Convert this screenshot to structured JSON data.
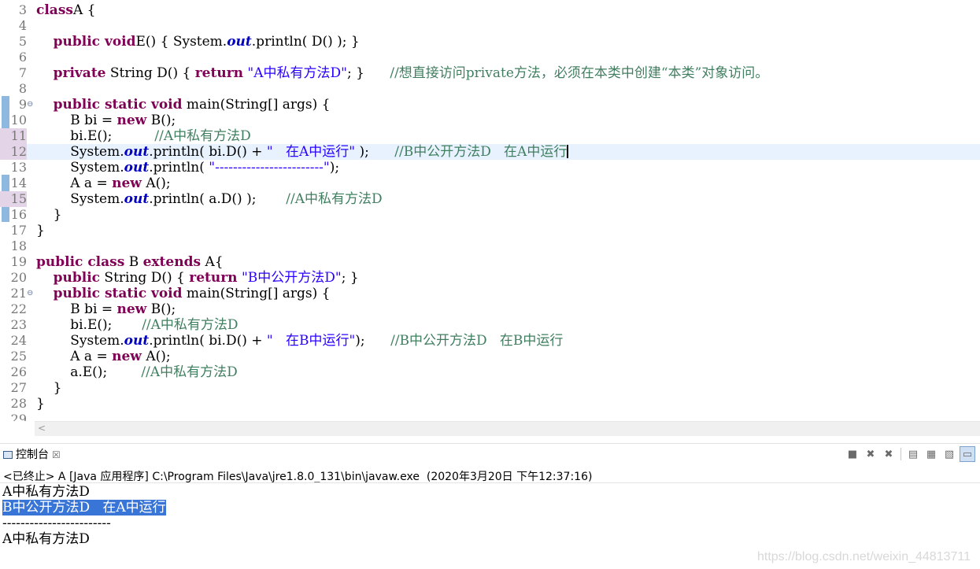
{
  "editor": {
    "current_line": "12",
    "lines": [
      {
        "n": "3",
        "mark": false,
        "fold": "",
        "current": false,
        "tokens": [
          [
            "kw",
            "class"
          ],
          [
            "",
            "A {"
          ]
        ]
      },
      {
        "n": "4",
        "mark": false,
        "fold": "",
        "current": false,
        "tokens": []
      },
      {
        "n": "5",
        "mark": false,
        "fold": "",
        "current": false,
        "tokens": [
          [
            "",
            "    "
          ],
          [
            "kw",
            "public void"
          ],
          [
            "",
            "E() { System."
          ],
          [
            "fld",
            "out"
          ],
          [
            "",
            ".println( D() ); }"
          ]
        ]
      },
      {
        "n": "6",
        "mark": false,
        "fold": "",
        "current": false,
        "tokens": []
      },
      {
        "n": "7",
        "mark": false,
        "fold": "",
        "current": false,
        "tokens": [
          [
            "",
            "    "
          ],
          [
            "kw",
            "private"
          ],
          [
            "",
            " String D() { "
          ],
          [
            "kw",
            "return"
          ],
          [
            "",
            " "
          ],
          [
            "str",
            "\"A中私有方法D\""
          ],
          [
            "",
            "; }      "
          ],
          [
            "cmt",
            "//想直接访问private方法，必须在本类中创建“本类”对象访问。"
          ]
        ]
      },
      {
        "n": "8",
        "mark": false,
        "fold": "",
        "current": false,
        "tokens": []
      },
      {
        "n": "9",
        "mark": false,
        "fold": "⊖",
        "current": false,
        "tokens": [
          [
            "",
            "    "
          ],
          [
            "kw",
            "public static void"
          ],
          [
            "",
            " main(String[] args) {"
          ]
        ]
      },
      {
        "n": "10",
        "mark": false,
        "fold": "",
        "current": false,
        "tokens": [
          [
            "",
            "        B bi = "
          ],
          [
            "kw",
            "new"
          ],
          [
            "",
            " B();"
          ]
        ]
      },
      {
        "n": "11",
        "mark": true,
        "fold": "",
        "current": false,
        "tokens": [
          [
            "",
            "        bi.E();          "
          ],
          [
            "cmt",
            "//A中私有方法D"
          ]
        ]
      },
      {
        "n": "12",
        "mark": true,
        "fold": "",
        "current": true,
        "tokens": [
          [
            "",
            "        System."
          ],
          [
            "fld",
            "out"
          ],
          [
            "",
            ".println( bi.D() + "
          ],
          [
            "str",
            "\"   在A中运行\""
          ],
          [
            "",
            " );      "
          ],
          [
            "cmt",
            "//B中公开方法D   在A中运行"
          ]
        ],
        "caret": true
      },
      {
        "n": "13",
        "mark": false,
        "fold": "",
        "current": false,
        "tokens": [
          [
            "",
            "        System."
          ],
          [
            "fld",
            "out"
          ],
          [
            "",
            ".println( "
          ],
          [
            "str",
            "\"------------------------\""
          ],
          [
            "",
            ");"
          ]
        ]
      },
      {
        "n": "14",
        "mark": false,
        "fold": "",
        "current": false,
        "tokens": [
          [
            "",
            "        A a = "
          ],
          [
            "kw",
            "new"
          ],
          [
            "",
            " A();"
          ]
        ]
      },
      {
        "n": "15",
        "mark": true,
        "fold": "",
        "current": false,
        "tokens": [
          [
            "",
            "        System."
          ],
          [
            "fld",
            "out"
          ],
          [
            "",
            ".println( a.D() );       "
          ],
          [
            "cmt",
            "//A中私有方法D"
          ]
        ]
      },
      {
        "n": "16",
        "mark": false,
        "fold": "",
        "current": false,
        "tokens": [
          [
            "",
            "    }"
          ]
        ]
      },
      {
        "n": "17",
        "mark": false,
        "fold": "",
        "current": false,
        "tokens": [
          [
            "",
            "}"
          ]
        ]
      },
      {
        "n": "18",
        "mark": false,
        "fold": "",
        "current": false,
        "tokens": []
      },
      {
        "n": "19",
        "mark": false,
        "fold": "",
        "current": false,
        "tokens": [
          [
            "kw",
            "public class"
          ],
          [
            "",
            " B "
          ],
          [
            "kw",
            "extends"
          ],
          [
            "",
            " A{"
          ]
        ]
      },
      {
        "n": "20",
        "mark": false,
        "fold": "",
        "current": false,
        "tokens": [
          [
            "",
            "    "
          ],
          [
            "kw",
            "public"
          ],
          [
            "",
            " String D() { "
          ],
          [
            "kw",
            "return"
          ],
          [
            "",
            " "
          ],
          [
            "str",
            "\"B中公开方法D\""
          ],
          [
            "",
            "; }"
          ]
        ]
      },
      {
        "n": "21",
        "mark": false,
        "fold": "⊖",
        "current": false,
        "tokens": [
          [
            "",
            "    "
          ],
          [
            "kw",
            "public static void"
          ],
          [
            "",
            " main(String[] args) {"
          ]
        ]
      },
      {
        "n": "22",
        "mark": false,
        "fold": "",
        "current": false,
        "tokens": [
          [
            "",
            "        B bi = "
          ],
          [
            "kw",
            "new"
          ],
          [
            "",
            " B();"
          ]
        ]
      },
      {
        "n": "23",
        "mark": false,
        "fold": "",
        "current": false,
        "tokens": [
          [
            "",
            "        bi.E();       "
          ],
          [
            "cmt",
            "//A中私有方法D"
          ]
        ]
      },
      {
        "n": "24",
        "mark": false,
        "fold": "",
        "current": false,
        "tokens": [
          [
            "",
            "        System."
          ],
          [
            "fld",
            "out"
          ],
          [
            "",
            ".println( bi.D() + "
          ],
          [
            "str",
            "\"   在B中运行\""
          ],
          [
            "",
            ");      "
          ],
          [
            "cmt",
            "//B中公开方法D   在B中运行"
          ]
        ]
      },
      {
        "n": "25",
        "mark": false,
        "fold": "",
        "current": false,
        "tokens": [
          [
            "",
            "        A a = "
          ],
          [
            "kw",
            "new"
          ],
          [
            "",
            " A();"
          ]
        ]
      },
      {
        "n": "26",
        "mark": false,
        "fold": "",
        "current": false,
        "tokens": [
          [
            "",
            "        a.E();        "
          ],
          [
            "cmt",
            "//A中私有方法D"
          ]
        ]
      },
      {
        "n": "27",
        "mark": false,
        "fold": "",
        "current": false,
        "tokens": [
          [
            "",
            "    }"
          ]
        ]
      },
      {
        "n": "28",
        "mark": false,
        "fold": "",
        "current": false,
        "tokens": [
          [
            "",
            "}"
          ]
        ]
      },
      {
        "n": "29",
        "mark": false,
        "fold": "",
        "current": false,
        "tokens": []
      }
    ]
  },
  "hscroll": {
    "left_arrow": "<"
  },
  "console": {
    "tab_label": "控制台",
    "tab_close": "☒",
    "terminated_line": "<已终止> A [Java 应用程序] C:\\Program Files\\Java\\jre1.8.0_131\\bin\\javaw.exe  (2020年3月20日 下午12:37:16)",
    "toolbar": [
      {
        "name": "terminate-icon",
        "glyph": "■"
      },
      {
        "name": "remove-launch-icon",
        "glyph": "✖"
      },
      {
        "name": "remove-all-launches-icon",
        "glyph": "✖"
      },
      {
        "sep": true
      },
      {
        "name": "clear-console-icon",
        "glyph": "▤"
      },
      {
        "name": "scroll-lock-icon",
        "glyph": "▦"
      },
      {
        "name": "word-wrap-icon",
        "glyph": "▧"
      },
      {
        "name": "show-console-icon",
        "glyph": "▭",
        "active": true
      }
    ],
    "output": [
      {
        "text": "A中私有方法D",
        "selected": false
      },
      {
        "text": "B中公开方法D   在A中运行",
        "selected": true
      },
      {
        "text": "------------------------",
        "selected": false
      },
      {
        "text": "A中私有方法D",
        "selected": false
      }
    ]
  },
  "watermark": "https://blog.csdn.net/weixin_44813711"
}
